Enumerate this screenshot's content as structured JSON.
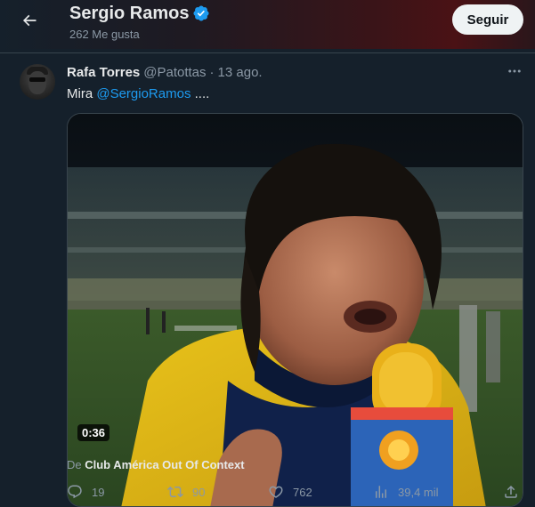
{
  "header": {
    "title": "Sergio Ramos",
    "subtitle": "262 Me gusta",
    "follow_label": "Seguir",
    "back_icon": "arrow-left-icon",
    "verified_icon": "verified-badge-icon"
  },
  "tweet": {
    "author_name": "Rafa Torres",
    "author_handle": "@Patottas",
    "separator": "·",
    "date": "13 ago.",
    "text_prefix": "Mira ",
    "mention": "@SergioRamos",
    "text_suffix": " ....",
    "video": {
      "duration": "0:36",
      "source_prefix": "De ",
      "source_name": "Club América Out Of Context"
    },
    "actions": {
      "replies": "19",
      "retweets": "90",
      "likes": "762",
      "views": "39,4 mil"
    }
  },
  "colors": {
    "background": "#15202b",
    "accent": "#1d9bf0",
    "secondary_text": "#8b98a5",
    "primary_text": "#e7e9ea"
  }
}
